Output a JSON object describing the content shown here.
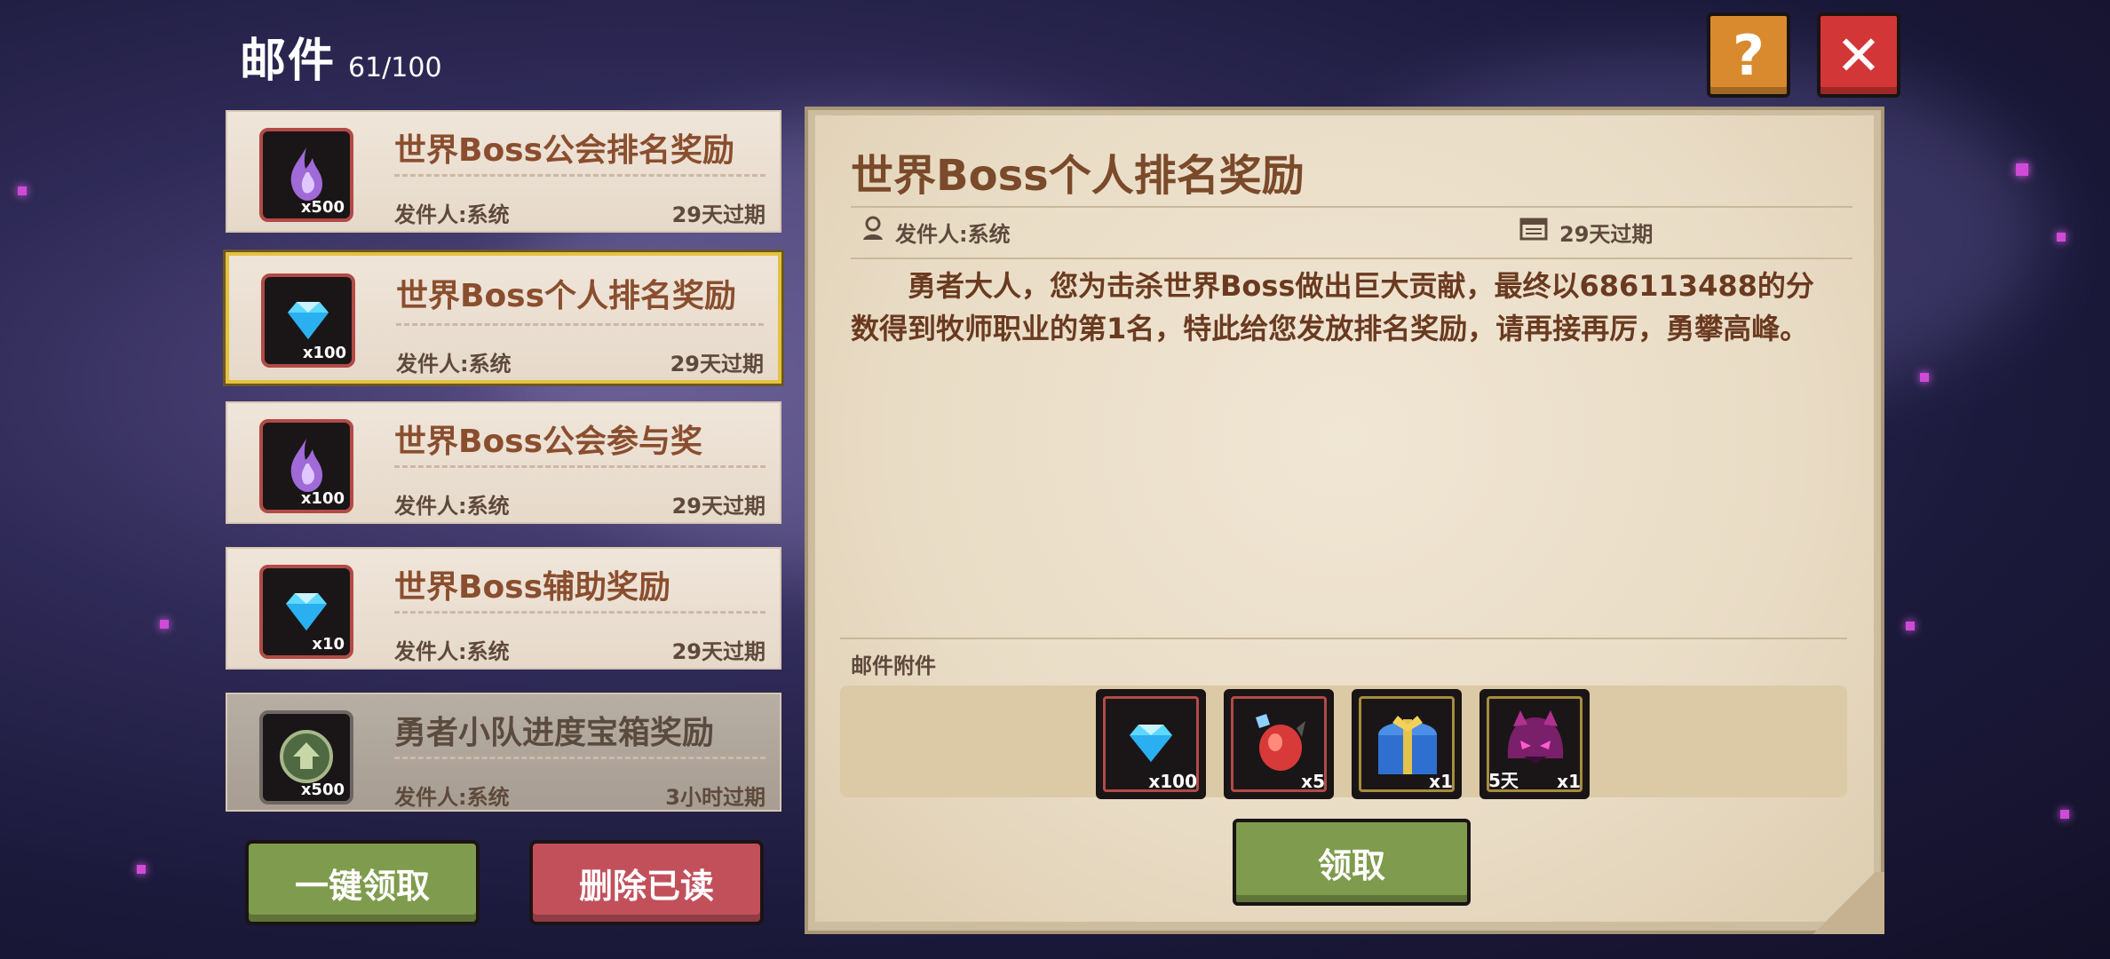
{
  "header": {
    "title": "邮件",
    "count": "61/100"
  },
  "controls": {
    "help_label": "?",
    "close_label": "✕"
  },
  "mail_list": [
    {
      "title": "世界Boss公会排名奖励",
      "sender": "发件人:系统",
      "expire": "29天过期",
      "qty": "x500",
      "icon": "purple-flame-icon",
      "state": "unread"
    },
    {
      "title": "世界Boss个人排名奖励",
      "sender": "发件人:系统",
      "expire": "29天过期",
      "qty": "x100",
      "icon": "blue-diamond-icon",
      "state": "selected"
    },
    {
      "title": "世界Boss公会参与奖",
      "sender": "发件人:系统",
      "expire": "29天过期",
      "qty": "x100",
      "icon": "purple-flame-icon",
      "state": "unread"
    },
    {
      "title": "世界Boss辅助奖励",
      "sender": "发件人:系统",
      "expire": "29天过期",
      "qty": "x10",
      "icon": "blue-diamond-icon",
      "state": "unread"
    },
    {
      "title": "勇者小队进度宝箱奖励",
      "sender": "发件人:系统",
      "expire": "3小时过期",
      "qty": "x500",
      "icon": "green-emblem-icon",
      "state": "read"
    }
  ],
  "actions": {
    "claim_all": "一键领取",
    "delete_read": "删除已读"
  },
  "detail": {
    "title": "世界Boss个人排名奖励",
    "sender": "发件人:系统",
    "expire": "29天过期",
    "body": "勇者大人，您为击杀世界Boss做出巨大贡献，最终以686113488的分数得到牧师职业的第1名，特此给您发放排名奖励，请再接再厉，勇攀高峰。",
    "attachments_label": "邮件附件",
    "attachments": [
      {
        "icon": "blue-diamond-icon",
        "qty": "x100",
        "days": ""
      },
      {
        "icon": "red-crystal-icon",
        "qty": "x5",
        "days": ""
      },
      {
        "icon": "blue-chest-icon",
        "qty": "x1",
        "days": ""
      },
      {
        "icon": "purple-pet-icon",
        "qty": "x1",
        "days": "5天"
      }
    ],
    "claim_label": "领取"
  },
  "colors": {
    "accent_gold": "#e3c23f",
    "button_green": "#7f9b4d",
    "button_red": "#c2505b",
    "title_brown": "#7a4a2a"
  }
}
